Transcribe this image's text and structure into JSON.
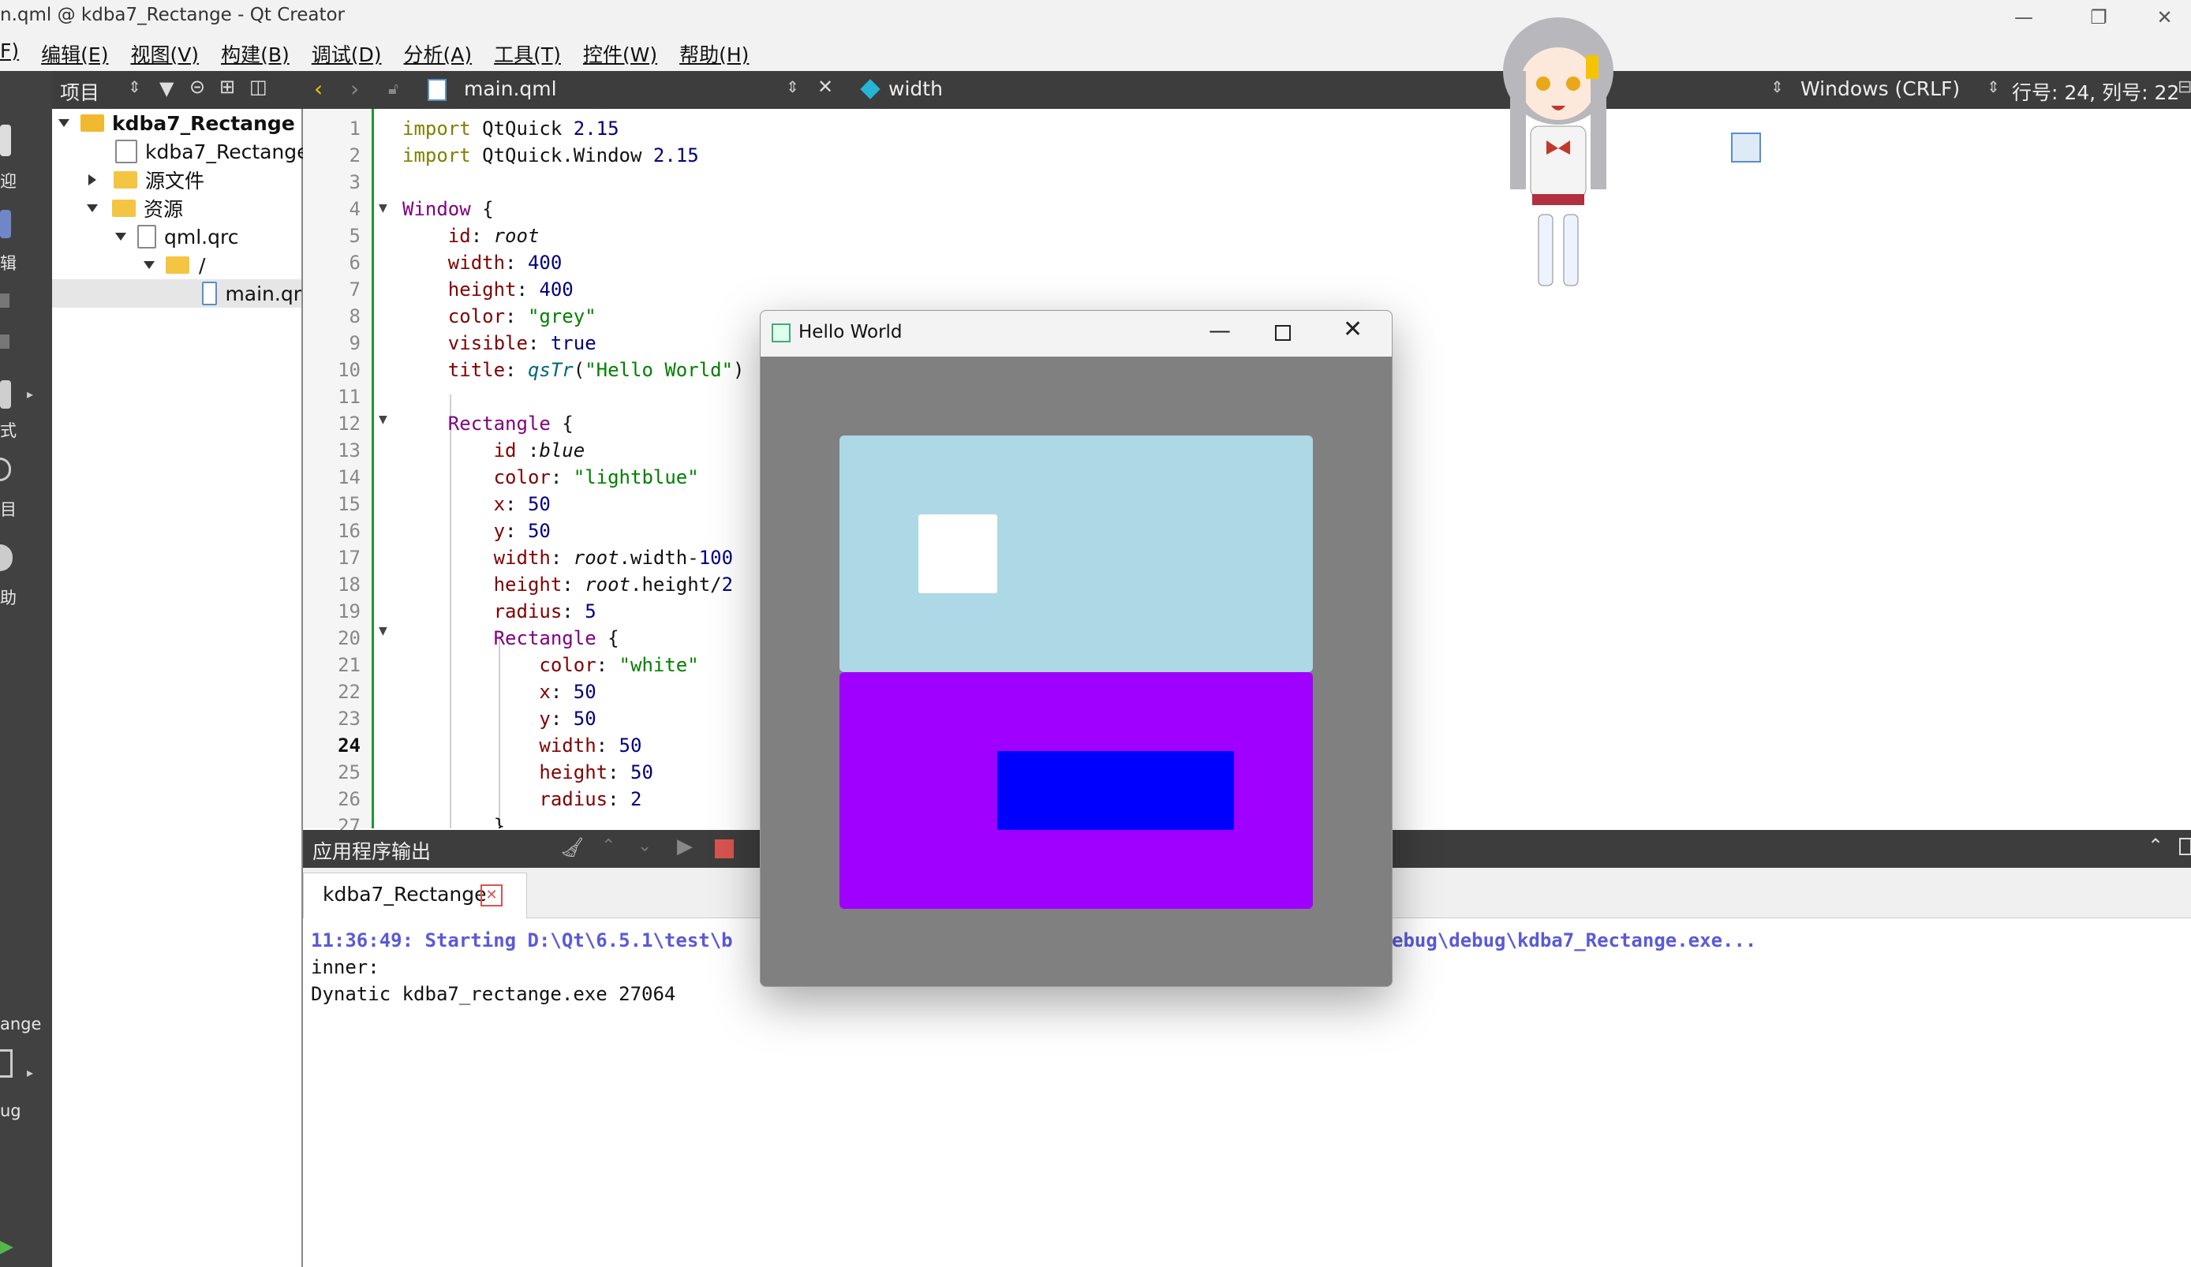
{
  "window": {
    "title": "n.qml @ kdba7_Rectange - Qt Creator"
  },
  "menu": [
    "F)",
    "编辑(E)",
    "视图(V)",
    "构建(B)",
    "调试(D)",
    "分析(A)",
    "工具(T)",
    "控件(W)",
    "帮助(H)"
  ],
  "modebar": {
    "labels": [
      "迎",
      "辑",
      "式",
      "目",
      "助",
      "ange",
      "ug"
    ]
  },
  "project_panel": {
    "header": "项目",
    "tree": [
      {
        "label": "kdba7_Rectange",
        "bold": true
      },
      {
        "label": "kdba7_Rectange."
      },
      {
        "label": "源文件"
      },
      {
        "label": "资源"
      },
      {
        "label": "qml.qrc"
      },
      {
        "label": "/"
      },
      {
        "label": "main.qr"
      }
    ]
  },
  "editor": {
    "file": "main.qml",
    "symbol": "width",
    "line_ending": "Windows (CRLF)",
    "position": "行号: 24, 列号: 22",
    "current_line": 24,
    "line_numbers": [
      "1",
      "2",
      "3",
      "4",
      "5",
      "6",
      "7",
      "8",
      "9",
      "10",
      "11",
      "12",
      "13",
      "14",
      "15",
      "16",
      "17",
      "18",
      "19",
      "20",
      "21",
      "22",
      "23",
      "24",
      "25",
      "26",
      "27"
    ]
  },
  "output": {
    "header": "应用程序输出",
    "tab": "kdba7_Rectange",
    "line1_left": "11:36:49: Starting D:\\Qt\\6.5.1\\test\\b",
    "line1_right": "ebug\\debug\\kdba7_Rectange.exe...",
    "line2": "inner:",
    "line3": "Dynatic kdba7_rectange.exe 27064"
  },
  "hello_window": {
    "title": "Hello World",
    "colors": {
      "bg": "#808080",
      "lightblue": "#add8e6",
      "white": "#ffffff",
      "purple": "#a000ff",
      "blue": "#0000ff"
    }
  }
}
